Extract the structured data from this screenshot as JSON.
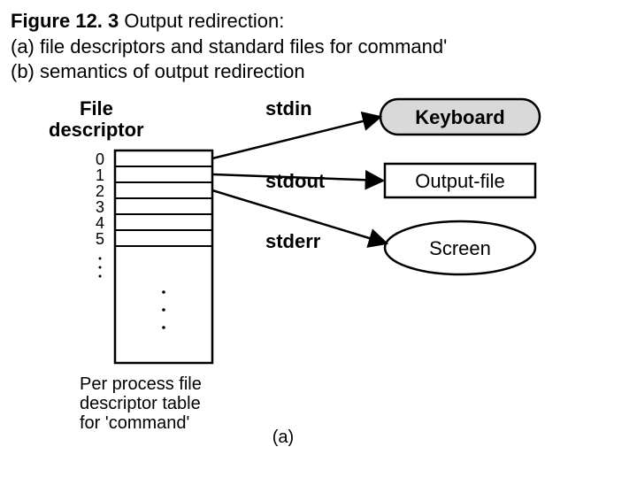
{
  "caption": {
    "fig_num": "Figure 12. 3",
    "title": "  Output redirection:",
    "line_a": "(a) file descriptors and standard files for command'",
    "line_b": "(b) semantics of output redirection"
  },
  "fd_header": "File\ndescriptor",
  "fd_indices": [
    "0",
    "1",
    "2",
    "3",
    "4",
    "5"
  ],
  "streams": {
    "stdin": "stdin",
    "stdout": "stdout",
    "stderr": "stderr"
  },
  "targets": {
    "keyboard": "Keyboard",
    "output_file": "Output-file",
    "screen": "Screen"
  },
  "bottom_label": "Per process file\ndescriptor table\nfor 'command'",
  "sub_label": "(a)"
}
